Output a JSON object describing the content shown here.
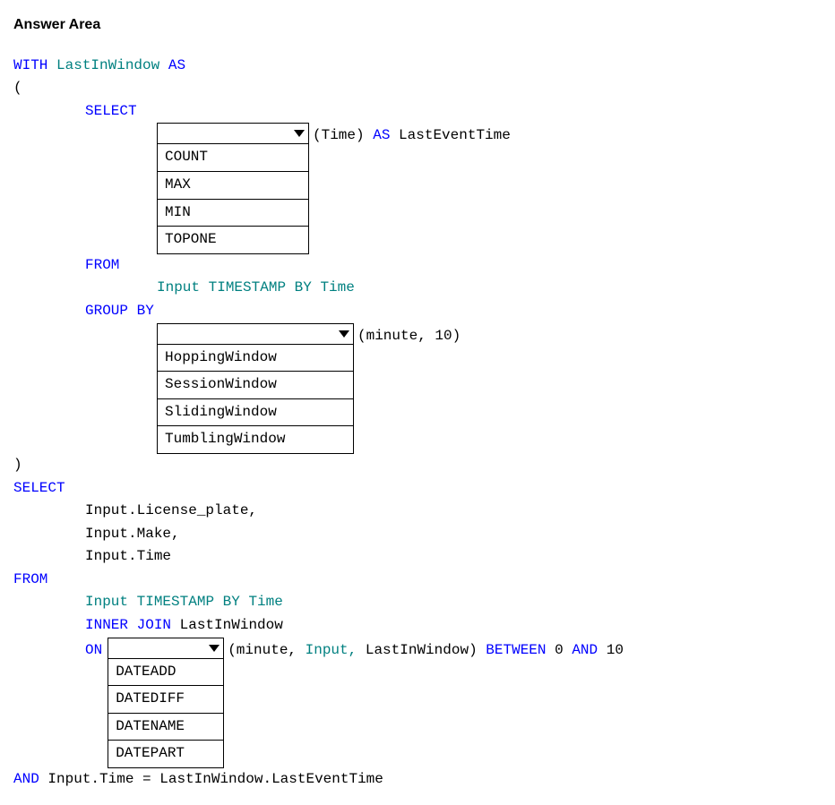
{
  "header": "Answer Area",
  "sql": {
    "with": "WITH",
    "cteName": "LastInWindow",
    "as": "AS",
    "openParen": "(",
    "select": "SELECT",
    "selectSuffix1": "(Time)",
    "selectAs": "AS",
    "selectAlias": "LastEventTime",
    "from": "FROM",
    "fromClause1": "Input",
    "timestampBy": "TIMESTAMP BY",
    "timeCol": "Time",
    "groupBy": "GROUP BY",
    "groupBySuffix": "(minute, 10)",
    "closeParen": ")",
    "select2": "SELECT",
    "col1": "Input.License_plate,",
    "col2": "Input.Make,",
    "col3": "Input.Time",
    "from2": "FROM",
    "fromClause2a": "Input",
    "fromClause2b": "TIMESTAMP BY",
    "fromClause2c": "Time",
    "innerJoin": "INNER JOIN",
    "joinTarget": "LastInWindow",
    "on": "ON",
    "onSuffix1": "(minute,",
    "onSuffix2": "Input,",
    "onSuffix3": "LastInWindow)",
    "between": "BETWEEN",
    "zero": "0",
    "and": "AND",
    "ten": "10",
    "and2": "AND",
    "finalClause": "Input.Time = LastInWindow.LastEventTime"
  },
  "dropdowns": {
    "dd1": {
      "options": [
        "COUNT",
        "MAX",
        "MIN",
        "TOPONE"
      ]
    },
    "dd2": {
      "options": [
        "HoppingWindow",
        "SessionWindow",
        "SlidingWindow",
        "TumblingWindow"
      ]
    },
    "dd3": {
      "options": [
        "DATEADD",
        "DATEDIFF",
        "DATENAME",
        "DATEPART"
      ]
    }
  }
}
